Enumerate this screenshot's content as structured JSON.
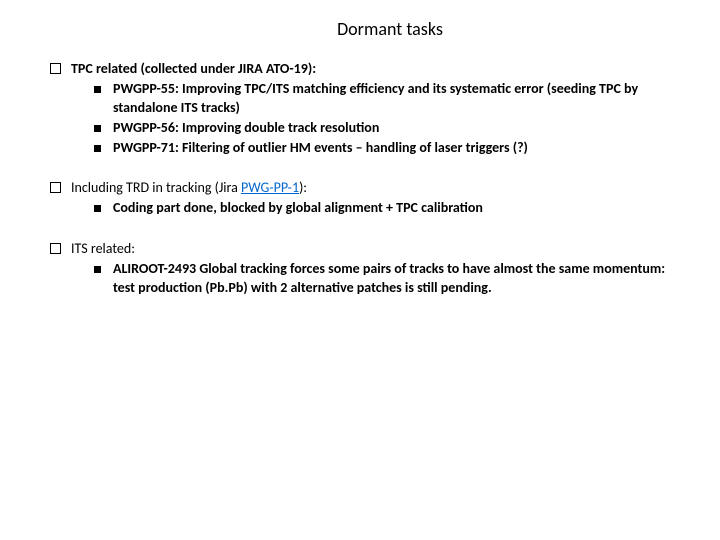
{
  "title": "Dormant tasks",
  "sections": [
    {
      "heading": "TPC related (collected under JIRA ATO-19):",
      "heading_bold": true,
      "items": [
        {
          "text": "PWGPP-55: Improving TPC/ITS matching efficiency and its systematic error (seeding TPC by standalone ITS tracks)",
          "bold": true
        },
        {
          "text": "PWGPP-56: Improving double track resolution",
          "bold": true
        },
        {
          "text": "PWGPP-71: Filtering of outlier HM events – handling of laser triggers (?)",
          "bold": true
        }
      ]
    },
    {
      "heading_pre": "Including TRD in tracking (Jira ",
      "heading_link": "PWG-PP-1",
      "heading_post": "):",
      "heading_bold": false,
      "items": [
        {
          "text": "Coding part done, blocked by global alignment + TPC calibration",
          "bold": true
        }
      ]
    },
    {
      "heading": "ITS related:",
      "heading_bold": false,
      "items": [
        {
          "text": "ALIROOT-2493 Global tracking forces some pairs of tracks to have almost the same momentum: test production (Pb.Pb) with 2 alternative patches is still pending.",
          "bold": true
        }
      ]
    }
  ]
}
